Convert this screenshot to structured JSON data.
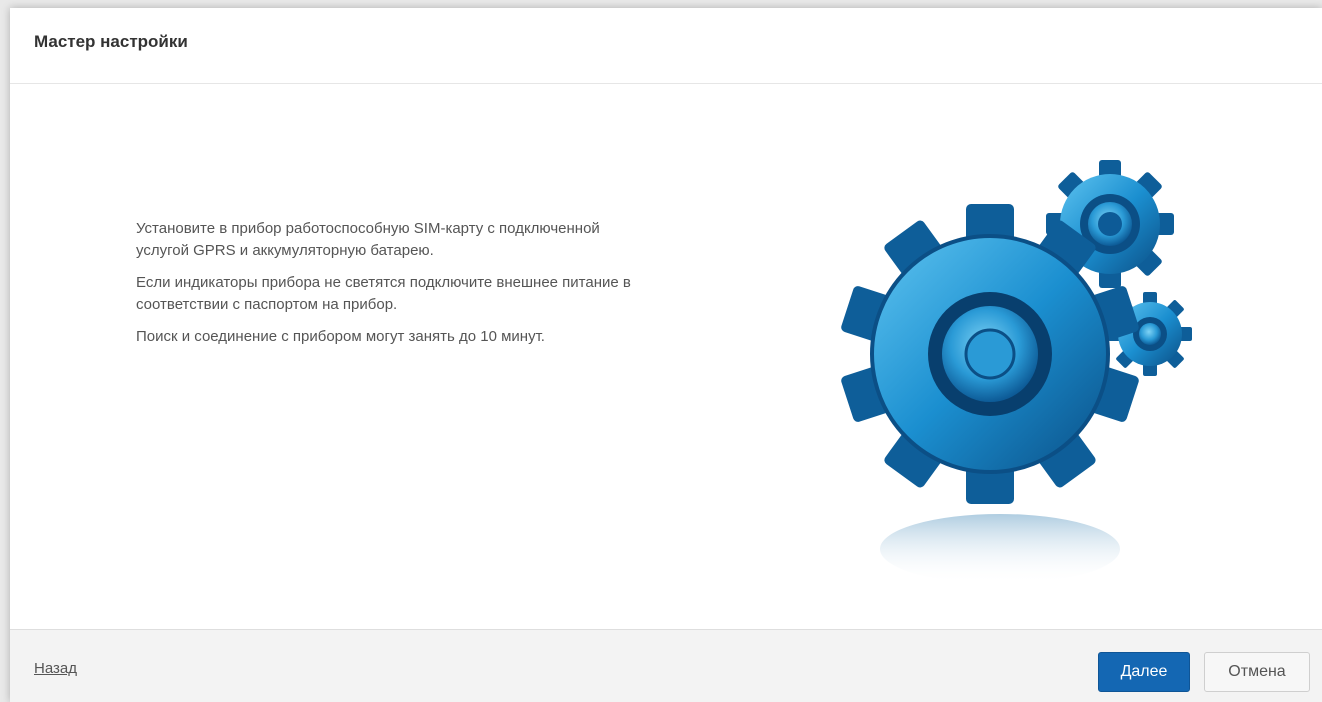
{
  "dialog": {
    "title": "Мастер настройки"
  },
  "instructions": {
    "paragraph1": "Установите в прибор работоспособную SIM-карту с подключенной услугой GPRS и аккумуляторную батарею.",
    "paragraph2": "Если индикаторы прибора не светятся подключите внешнее питание в соответствии с паспортом на прибор.",
    "paragraph3": "Поиск и соединение с прибором могут занять до 10 минут."
  },
  "illustration": {
    "icon": "gears-icon",
    "colors": {
      "primary": "#1b8fd0",
      "dark": "#0b4f86",
      "light": "#5fc4f0"
    }
  },
  "footer": {
    "back_label": "Назад",
    "next_label": "Далее",
    "cancel_label": "Отмена"
  },
  "colors": {
    "accent": "#1467b3"
  }
}
